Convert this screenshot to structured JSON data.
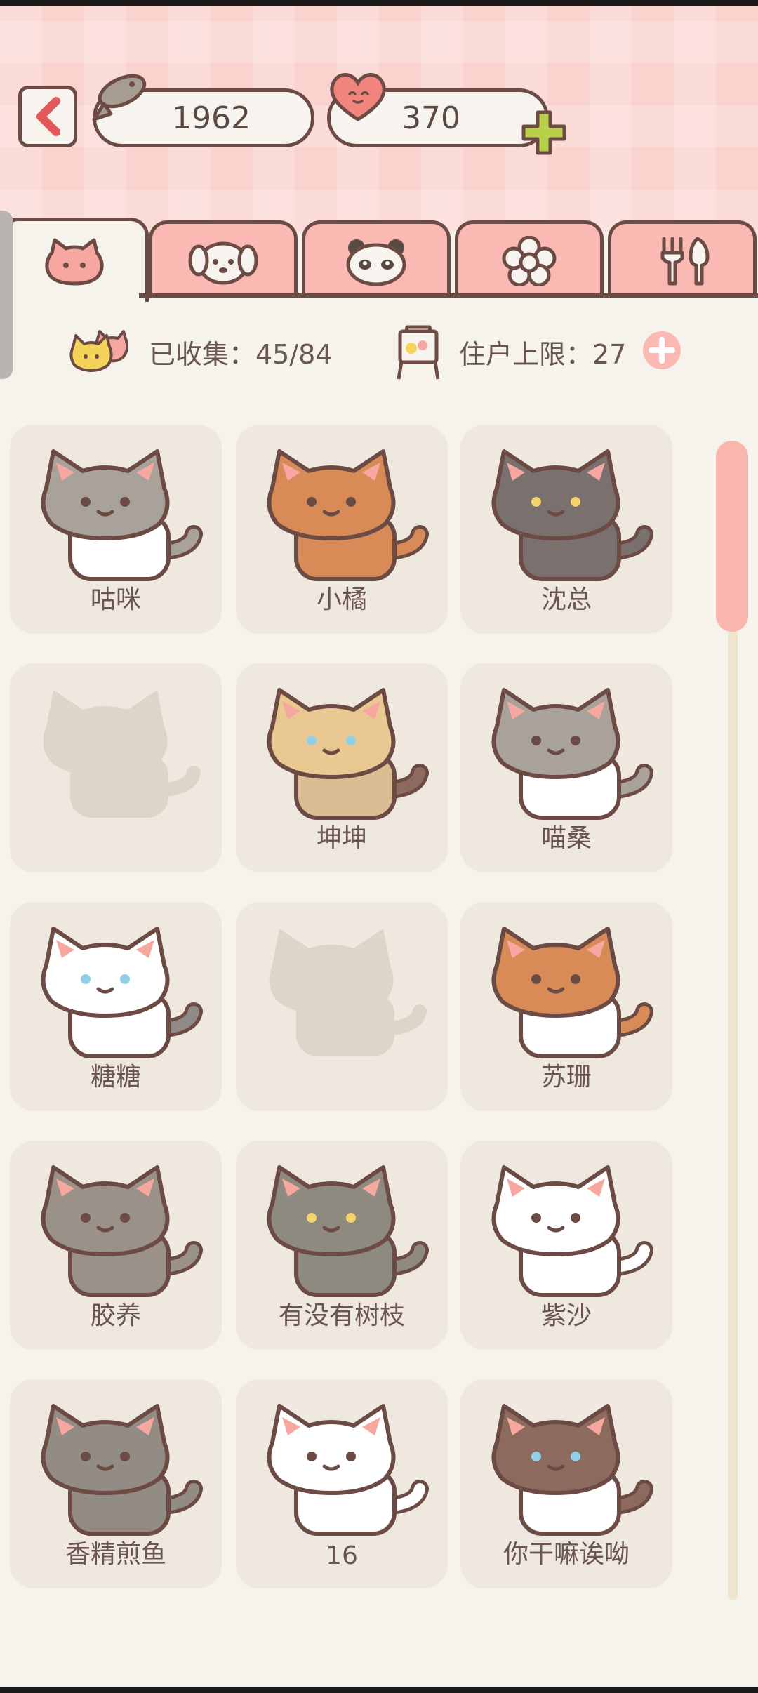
{
  "header": {
    "fish_count": "1962",
    "heart_count": "370"
  },
  "tabs": [
    {
      "icon": "cat-icon",
      "active": true
    },
    {
      "icon": "dog-icon",
      "active": false
    },
    {
      "icon": "panda-icon",
      "active": false
    },
    {
      "icon": "flower-icon",
      "active": false
    },
    {
      "icon": "utensils-icon",
      "active": false
    }
  ],
  "stats": {
    "collected_label": "已收集：45/84",
    "capacity_label": "住户上限：27"
  },
  "cats": [
    {
      "name": "咕咪",
      "locked": false,
      "head": "#a8a29b",
      "body": "#ffffff",
      "tail": "#a8a29b",
      "eyes": "#6d4b45"
    },
    {
      "name": "小橘",
      "locked": false,
      "head": "#d88a57",
      "body": "#d88a57",
      "tail": "#d88a57",
      "eyes": "#6d4b45"
    },
    {
      "name": "沈总",
      "locked": false,
      "head": "#7a706e",
      "body": "#7a706e",
      "tail": "#7a706e",
      "eyes": "#f5d36b"
    },
    {
      "name": "",
      "locked": true,
      "head": "#dcd5c9",
      "body": "#dcd5c9",
      "tail": "#dcd5c9",
      "eyes": "#dcd5c9"
    },
    {
      "name": "坤坤",
      "locked": false,
      "head": "#e9c891",
      "body": "#d8be92",
      "tail": "#8c6a5e",
      "eyes": "#8fd0e8"
    },
    {
      "name": "喵桑",
      "locked": false,
      "head": "#a8a29b",
      "body": "#ffffff",
      "tail": "#a8a29b",
      "eyes": "#6d4b45"
    },
    {
      "name": "糖糖",
      "locked": false,
      "head": "#ffffff",
      "body": "#ffffff",
      "tail": "#8f8a88",
      "eyes": "#8fd0e8"
    },
    {
      "name": "",
      "locked": true,
      "head": "#dcd5c9",
      "body": "#dcd5c9",
      "tail": "#dcd5c9",
      "eyes": "#dcd5c9"
    },
    {
      "name": "苏珊",
      "locked": false,
      "head": "#d88a57",
      "body": "#ffffff",
      "tail": "#d88a57",
      "eyes": "#6d4b45"
    },
    {
      "name": "胶养",
      "locked": false,
      "head": "#9a9188",
      "body": "#9a9188",
      "tail": "#9a9188",
      "eyes": "#6d4b45"
    },
    {
      "name": "有没有树枝",
      "locked": false,
      "head": "#8f8a7f",
      "body": "#8f8a7f",
      "tail": "#8f8a7f",
      "eyes": "#f5d36b"
    },
    {
      "name": "紫沙",
      "locked": false,
      "head": "#ffffff",
      "body": "#ffffff",
      "tail": "#ffffff",
      "eyes": "#6d4b45"
    },
    {
      "name": "香精煎鱼",
      "locked": false,
      "head": "#938c84",
      "body": "#938c84",
      "tail": "#938c84",
      "eyes": "#6d4b45"
    },
    {
      "name": "16",
      "locked": false,
      "head": "#ffffff",
      "body": "#ffffff",
      "tail": "#ffffff",
      "eyes": "#6d4b45"
    },
    {
      "name": "你干嘛诶呦",
      "locked": false,
      "head": "#8c6a5e",
      "body": "#ffffff",
      "tail": "#8c6a5e",
      "eyes": "#8fd0e8"
    }
  ]
}
